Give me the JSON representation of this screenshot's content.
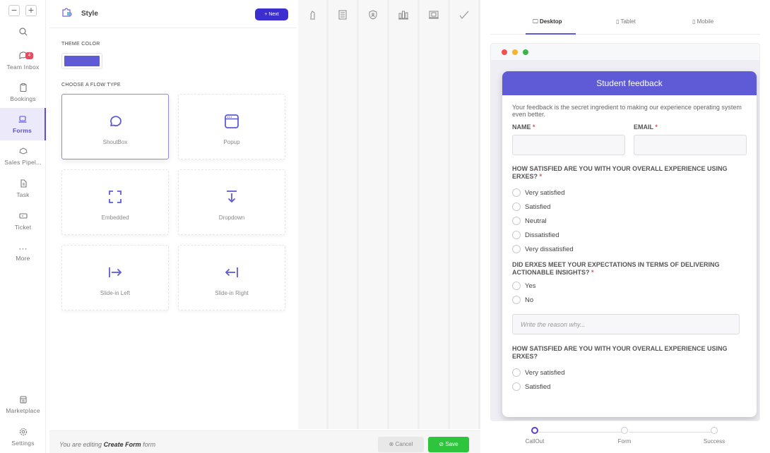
{
  "nav": {
    "zoom_out": "−",
    "zoom_in": "+",
    "items": [
      {
        "label": "",
        "icon": "search-icon"
      },
      {
        "label": "Team Inbox",
        "icon": "chat-icon",
        "badge": "4"
      },
      {
        "label": "Bookings",
        "icon": "clipboard-icon"
      },
      {
        "label": "Forms",
        "icon": "laptop-icon",
        "active": true
      },
      {
        "label": "Sales Pipel...",
        "icon": "pipeline-icon"
      },
      {
        "label": "Task",
        "icon": "task-icon"
      },
      {
        "label": "Ticket",
        "icon": "ticket-icon"
      },
      {
        "label": "More",
        "icon": "more-icon"
      },
      {
        "label": "Marketplace",
        "icon": "store-icon"
      },
      {
        "label": "Settings",
        "icon": "gear-icon"
      }
    ]
  },
  "style_panel": {
    "title": "Style",
    "next_label": "+ Next",
    "theme_color_label": "THEME COLOR",
    "theme_color": "#5f5bd6",
    "flow_type_label": "CHOOSE A FLOW TYPE",
    "flow_types": [
      {
        "label": "ShoutBox",
        "icon": "chat-bubble-icon",
        "selected": true
      },
      {
        "label": "Popup",
        "icon": "window-icon"
      },
      {
        "label": "Embedded",
        "icon": "embed-frame-icon"
      },
      {
        "label": "Dropdown",
        "icon": "dropdown-arrow-icon"
      },
      {
        "label": "Slide-in Left",
        "icon": "slide-right-icon"
      },
      {
        "label": "Slide-in Right",
        "icon": "slide-left-icon"
      }
    ]
  },
  "steps_columns": [
    {
      "icon": "chess-knight-icon"
    },
    {
      "icon": "newspaper-icon"
    },
    {
      "icon": "shield-user-icon"
    },
    {
      "icon": "building-chart-icon"
    },
    {
      "icon": "laptop-image-icon"
    },
    {
      "icon": "check-pen-icon"
    }
  ],
  "bottom_bar": {
    "editing_prefix": "You are editing",
    "form_name": "Create Form",
    "editing_suffix": "form",
    "cancel_label": "⊗ Cancel",
    "save_label": "⊘ Save"
  },
  "preview": {
    "tabs": [
      {
        "label": "Desktop",
        "icon": "monitor-icon",
        "active": true
      },
      {
        "label": "Tablet",
        "icon": "tablet-icon"
      },
      {
        "label": "Mobile",
        "icon": "mobile-icon"
      }
    ],
    "form": {
      "title": "Student feedback",
      "description": "Your feedback is the secret ingredient to making our experience operating system even better.",
      "name_label": "NAME",
      "email_label": "EMAIL",
      "required_mark": "*",
      "q1": "HOW SATISFIED ARE YOU WITH YOUR OVERALL EXPERIENCE USING ERXES?",
      "q1_options": [
        "Very satisfied",
        "Satisfied",
        "Neutral",
        "Dissatisfied",
        "Very dissatisfied"
      ],
      "q2": "DID ERXES MEET YOUR EXPECTATIONS IN TERMS OF DELIVERING ACTIONABLE INSIGHTS?",
      "q2_options": [
        "Yes",
        "No"
      ],
      "reason_placeholder": "Write the reason why...",
      "q3": "HOW SATISFIED ARE YOU WITH YOUR OVERALL EXPERIENCE USING ERXES?",
      "q3_options": [
        "Very satisfied",
        "Satisfied"
      ]
    },
    "steps": [
      {
        "label": "CallOut",
        "active": true
      },
      {
        "label": "Form"
      },
      {
        "label": "Success"
      }
    ]
  }
}
